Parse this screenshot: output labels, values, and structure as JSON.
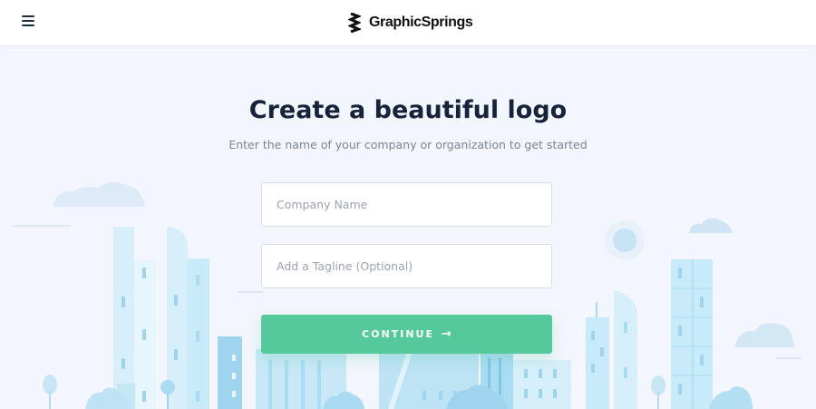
{
  "header": {
    "brand_name": "GraphicSprings",
    "menu_icon": "hamburger-menu-icon"
  },
  "hero": {
    "title": "Create a beautiful logo",
    "subtitle": "Enter the name of your company or organization to get started"
  },
  "form": {
    "company_placeholder": "Company Name",
    "company_value": "",
    "tagline_placeholder": "Add a Tagline (Optional)",
    "tagline_value": "",
    "continue_label": "CONTINUE",
    "continue_icon": "arrow-right-icon"
  },
  "colors": {
    "accent": "#55c99c",
    "title": "#17233b",
    "background": "#f3f6fc",
    "building_light": "#d6effa",
    "building_mid": "#a9dcf2",
    "building_dark": "#7fc6e6"
  }
}
